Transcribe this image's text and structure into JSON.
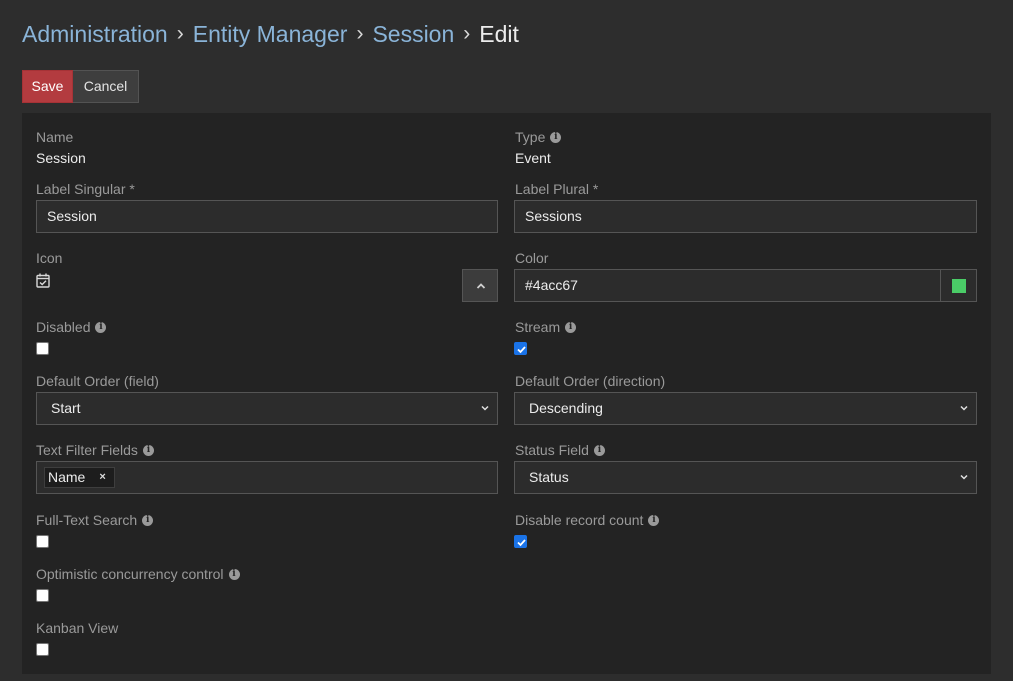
{
  "breadcrumb": {
    "items": [
      "Administration",
      "Entity Manager",
      "Session"
    ],
    "current": "Edit",
    "separator": "›"
  },
  "actions": {
    "save_label": "Save",
    "cancel_label": "Cancel"
  },
  "form": {
    "name": {
      "label": "Name",
      "value": "Session"
    },
    "type": {
      "label": "Type",
      "value": "Event"
    },
    "label_singular": {
      "label": "Label Singular *",
      "value": "Session"
    },
    "label_plural": {
      "label": "Label Plural *",
      "value": "Sessions"
    },
    "icon": {
      "label": "Icon",
      "icon_name": "calendar-check-icon"
    },
    "color": {
      "label": "Color",
      "value": "#4acc67",
      "swatch": "#4acc67"
    },
    "disabled": {
      "label": "Disabled",
      "checked": false
    },
    "stream": {
      "label": "Stream",
      "checked": true
    },
    "default_order_field": {
      "label": "Default Order (field)",
      "value": "Start"
    },
    "default_order_direction": {
      "label": "Default Order (direction)",
      "value": "Descending"
    },
    "text_filter_fields": {
      "label": "Text Filter Fields",
      "tags": [
        "Name"
      ]
    },
    "status_field": {
      "label": "Status Field",
      "value": "Status"
    },
    "full_text_search": {
      "label": "Full-Text Search",
      "checked": false
    },
    "disable_record_count": {
      "label": "Disable record count",
      "checked": true
    },
    "optimistic_concurrency": {
      "label": "Optimistic concurrency control",
      "checked": false
    },
    "kanban_view": {
      "label": "Kanban View",
      "checked": false
    }
  },
  "colors": {
    "background": "#2d2d2d",
    "panel": "#232323",
    "link": "#8ab4d8",
    "save_button": "#b33b3f",
    "checkbox_checked": "#1a73e8"
  }
}
